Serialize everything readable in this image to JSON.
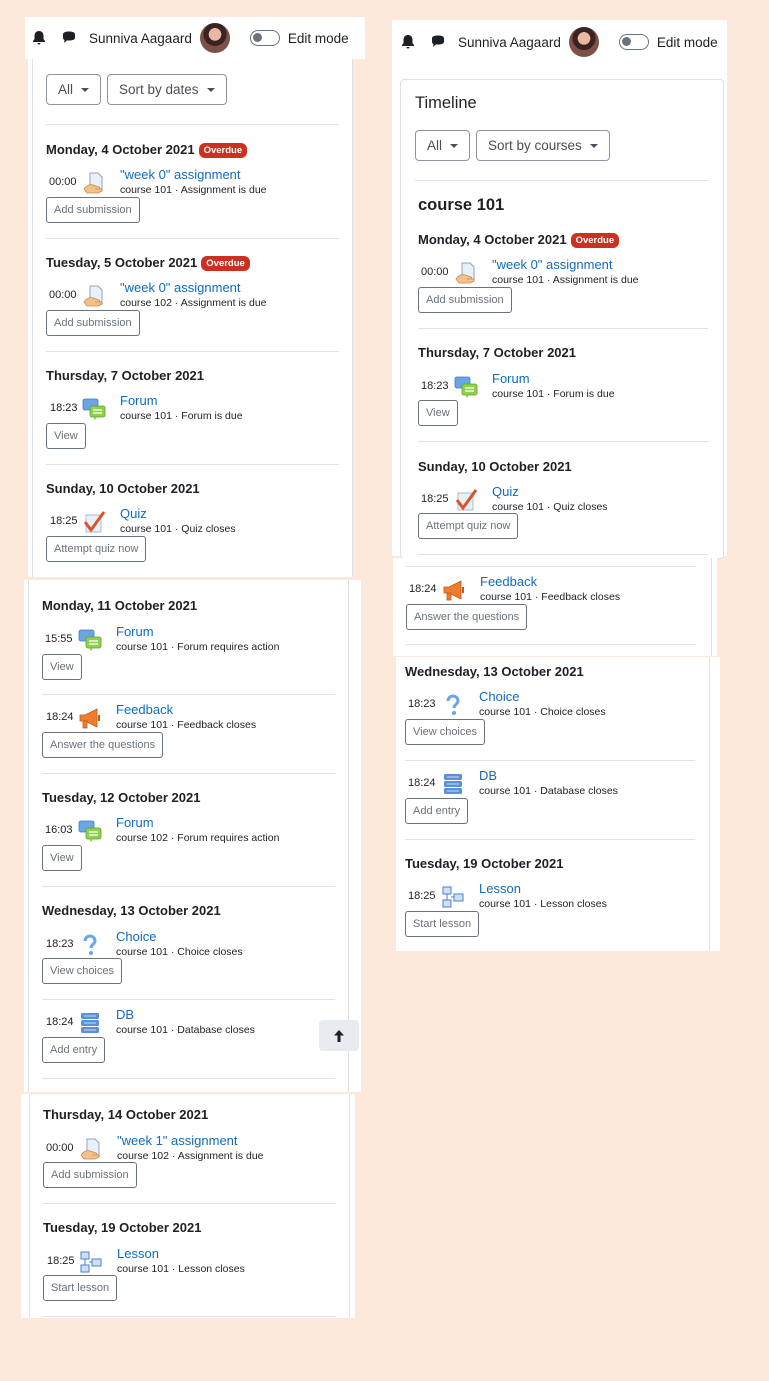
{
  "header": {
    "user_name": "Sunniva Aagaard",
    "edit_mode_label": "Edit mode",
    "notification_icon": "bell-icon",
    "message_icon": "chat-bubble-icon",
    "edit_mode_on": false
  },
  "left": {
    "filter_all": "All",
    "sort_label": "Sort by dates",
    "day_a1": "Monday, 4 October 2021",
    "day_a2": "Tuesday, 5 October 2021",
    "day_a3": "Thursday, 7 October 2021",
    "day_a4": "Sunday, 10 October 2021",
    "day_b1": "Monday, 11 October 2021",
    "day_b2": "Tuesday, 12 October 2021",
    "day_b3": "Wednesday, 13 October 2021",
    "day_c1": "Thursday, 14 October 2021",
    "day_c2": "Tuesday, 19 October 2021",
    "overdue": "Overdue",
    "events": [
      {
        "time": "00:00",
        "name": "\"week 0\" assignment",
        "sub": "course 101 · Assignment is due",
        "action": "Add submission",
        "icon": "assignment-icon"
      },
      {
        "time": "00:00",
        "name": "\"week 0\" assignment",
        "sub": "course 102 · Assignment is due",
        "action": "Add submission",
        "icon": "assignment-icon"
      },
      {
        "time": "18:23",
        "name": "Forum",
        "sub": "course 101 · Forum is due",
        "action": "View",
        "icon": "forum-icon"
      },
      {
        "time": "18:25",
        "name": "Quiz",
        "sub": "course 101 · Quiz closes",
        "action": "Attempt quiz now",
        "icon": "quiz-icon"
      },
      {
        "time": "15:55",
        "name": "Forum",
        "sub": "course 101 · Forum requires action",
        "action": "View",
        "icon": "forum-icon"
      },
      {
        "time": "18:24",
        "name": "Feedback",
        "sub": "course 101 · Feedback closes",
        "action": "Answer the questions",
        "icon": "feedback-icon"
      },
      {
        "time": "16:03",
        "name": "Forum",
        "sub": "course 102 · Forum requires action",
        "action": "View",
        "icon": "forum-icon"
      },
      {
        "time": "18:23",
        "name": "Choice",
        "sub": "course 101 · Choice closes",
        "action": "View choices",
        "icon": "choice-icon"
      },
      {
        "time": "18:24",
        "name": "DB",
        "sub": "course 101 · Database closes",
        "action": "Add entry",
        "icon": "database-icon"
      },
      {
        "time": "00:00",
        "name": "\"week 1\" assignment",
        "sub": "course 102 · Assignment is due",
        "action": "Add submission",
        "icon": "assignment-icon"
      },
      {
        "time": "18:25",
        "name": "Lesson",
        "sub": "course 101 · Lesson closes",
        "action": "Start lesson",
        "icon": "lesson-icon"
      }
    ]
  },
  "right": {
    "timeline_title": "Timeline",
    "filter_all": "All",
    "sort_label": "Sort by courses",
    "course_name": "course 101",
    "day_1": "Monday, 4 October 2021",
    "day_2": "Thursday, 7 October 2021",
    "day_3": "Sunday, 10 October 2021",
    "day_4": "Wednesday, 13 October 2021",
    "day_5": "Tuesday, 19 October 2021",
    "overdue": "Overdue",
    "events": [
      {
        "time": "00:00",
        "name": "\"week 0\" assignment",
        "sub": "course 101 · Assignment is due",
        "action": "Add submission",
        "icon": "assignment-icon"
      },
      {
        "time": "18:23",
        "name": "Forum",
        "sub": "course 101 · Forum is due",
        "action": "View",
        "icon": "forum-icon"
      },
      {
        "time": "18:25",
        "name": "Quiz",
        "sub": "course 101 · Quiz closes",
        "action": "Attempt quiz now",
        "icon": "quiz-icon"
      },
      {
        "time": "18:24",
        "name": "Feedback",
        "sub": "course 101 · Feedback closes",
        "action": "Answer the questions",
        "icon": "feedback-icon"
      },
      {
        "time": "18:23",
        "name": "Choice",
        "sub": "course 101 · Choice closes",
        "action": "View choices",
        "icon": "choice-icon"
      },
      {
        "time": "18:24",
        "name": "DB",
        "sub": "course 101 · Database closes",
        "action": "Add entry",
        "icon": "database-icon"
      },
      {
        "time": "18:25",
        "name": "Lesson",
        "sub": "course 101 · Lesson closes",
        "action": "Start lesson",
        "icon": "lesson-icon"
      }
    ]
  },
  "back_to_top_icon": "arrow-up-icon"
}
